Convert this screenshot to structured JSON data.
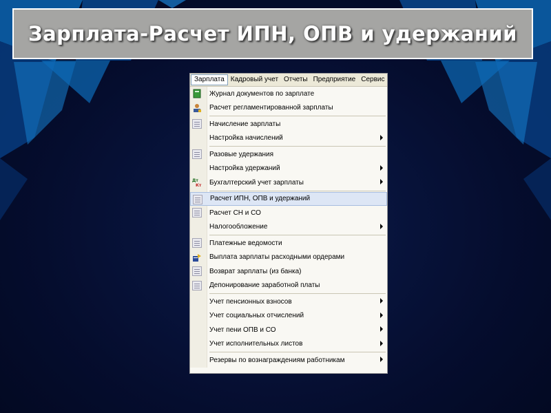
{
  "slide": {
    "title": "Зарплата-Расчет ИПН, ОПВ и удержаний"
  },
  "menubar": {
    "items": [
      "Зарплата",
      "Кадровый учет",
      "Отчеты",
      "Предприятие",
      "Сервис"
    ]
  },
  "menu": {
    "items": [
      {
        "label": "Журнал документов по зарплате",
        "icon": "journal-icon"
      },
      {
        "label": "Расчет регламентированной зарплаты",
        "icon": "user-calc-icon"
      },
      {
        "label": "Начисление зарплаты",
        "icon": "document-icon"
      },
      {
        "label": "Настройка начислений",
        "submenu": true
      },
      {
        "label": "Разовые удержания",
        "icon": "document-icon"
      },
      {
        "label": "Настройка удержаний",
        "submenu": true
      },
      {
        "label": "Бухгалтерский учет зарплаты",
        "icon": "dt-kt-icon",
        "submenu": true
      },
      {
        "label": "Расчет ИПН, ОПВ и удержаний",
        "icon": "document-icon",
        "highlighted": true
      },
      {
        "label": "Расчет СН и СО",
        "icon": "document-icon"
      },
      {
        "label": "Налогообложение",
        "submenu": true
      },
      {
        "label": "Платежные ведомости",
        "icon": "document-icon"
      },
      {
        "label": "Выплата зарплаты расходными ордерами",
        "icon": "payout-icon"
      },
      {
        "label": "Возврат зарплаты (из банка)",
        "icon": "document-icon"
      },
      {
        "label": "Депонирование заработной платы",
        "icon": "document-icon"
      },
      {
        "label": "Учет пенсионных взносов",
        "submenu": true
      },
      {
        "label": "Учет социальных отчислений",
        "submenu": true
      },
      {
        "label": "Учет пени ОПВ и СО",
        "submenu": true
      },
      {
        "label": "Учет исполнительных листов",
        "submenu": true
      },
      {
        "label": "Резервы по вознаграждениям работникам",
        "submenu": true
      }
    ]
  },
  "colors": {
    "background": "#050d2e",
    "accent": "#1f9bd8",
    "title_box": "#a5a5a3",
    "highlight": "#dde6f5"
  }
}
